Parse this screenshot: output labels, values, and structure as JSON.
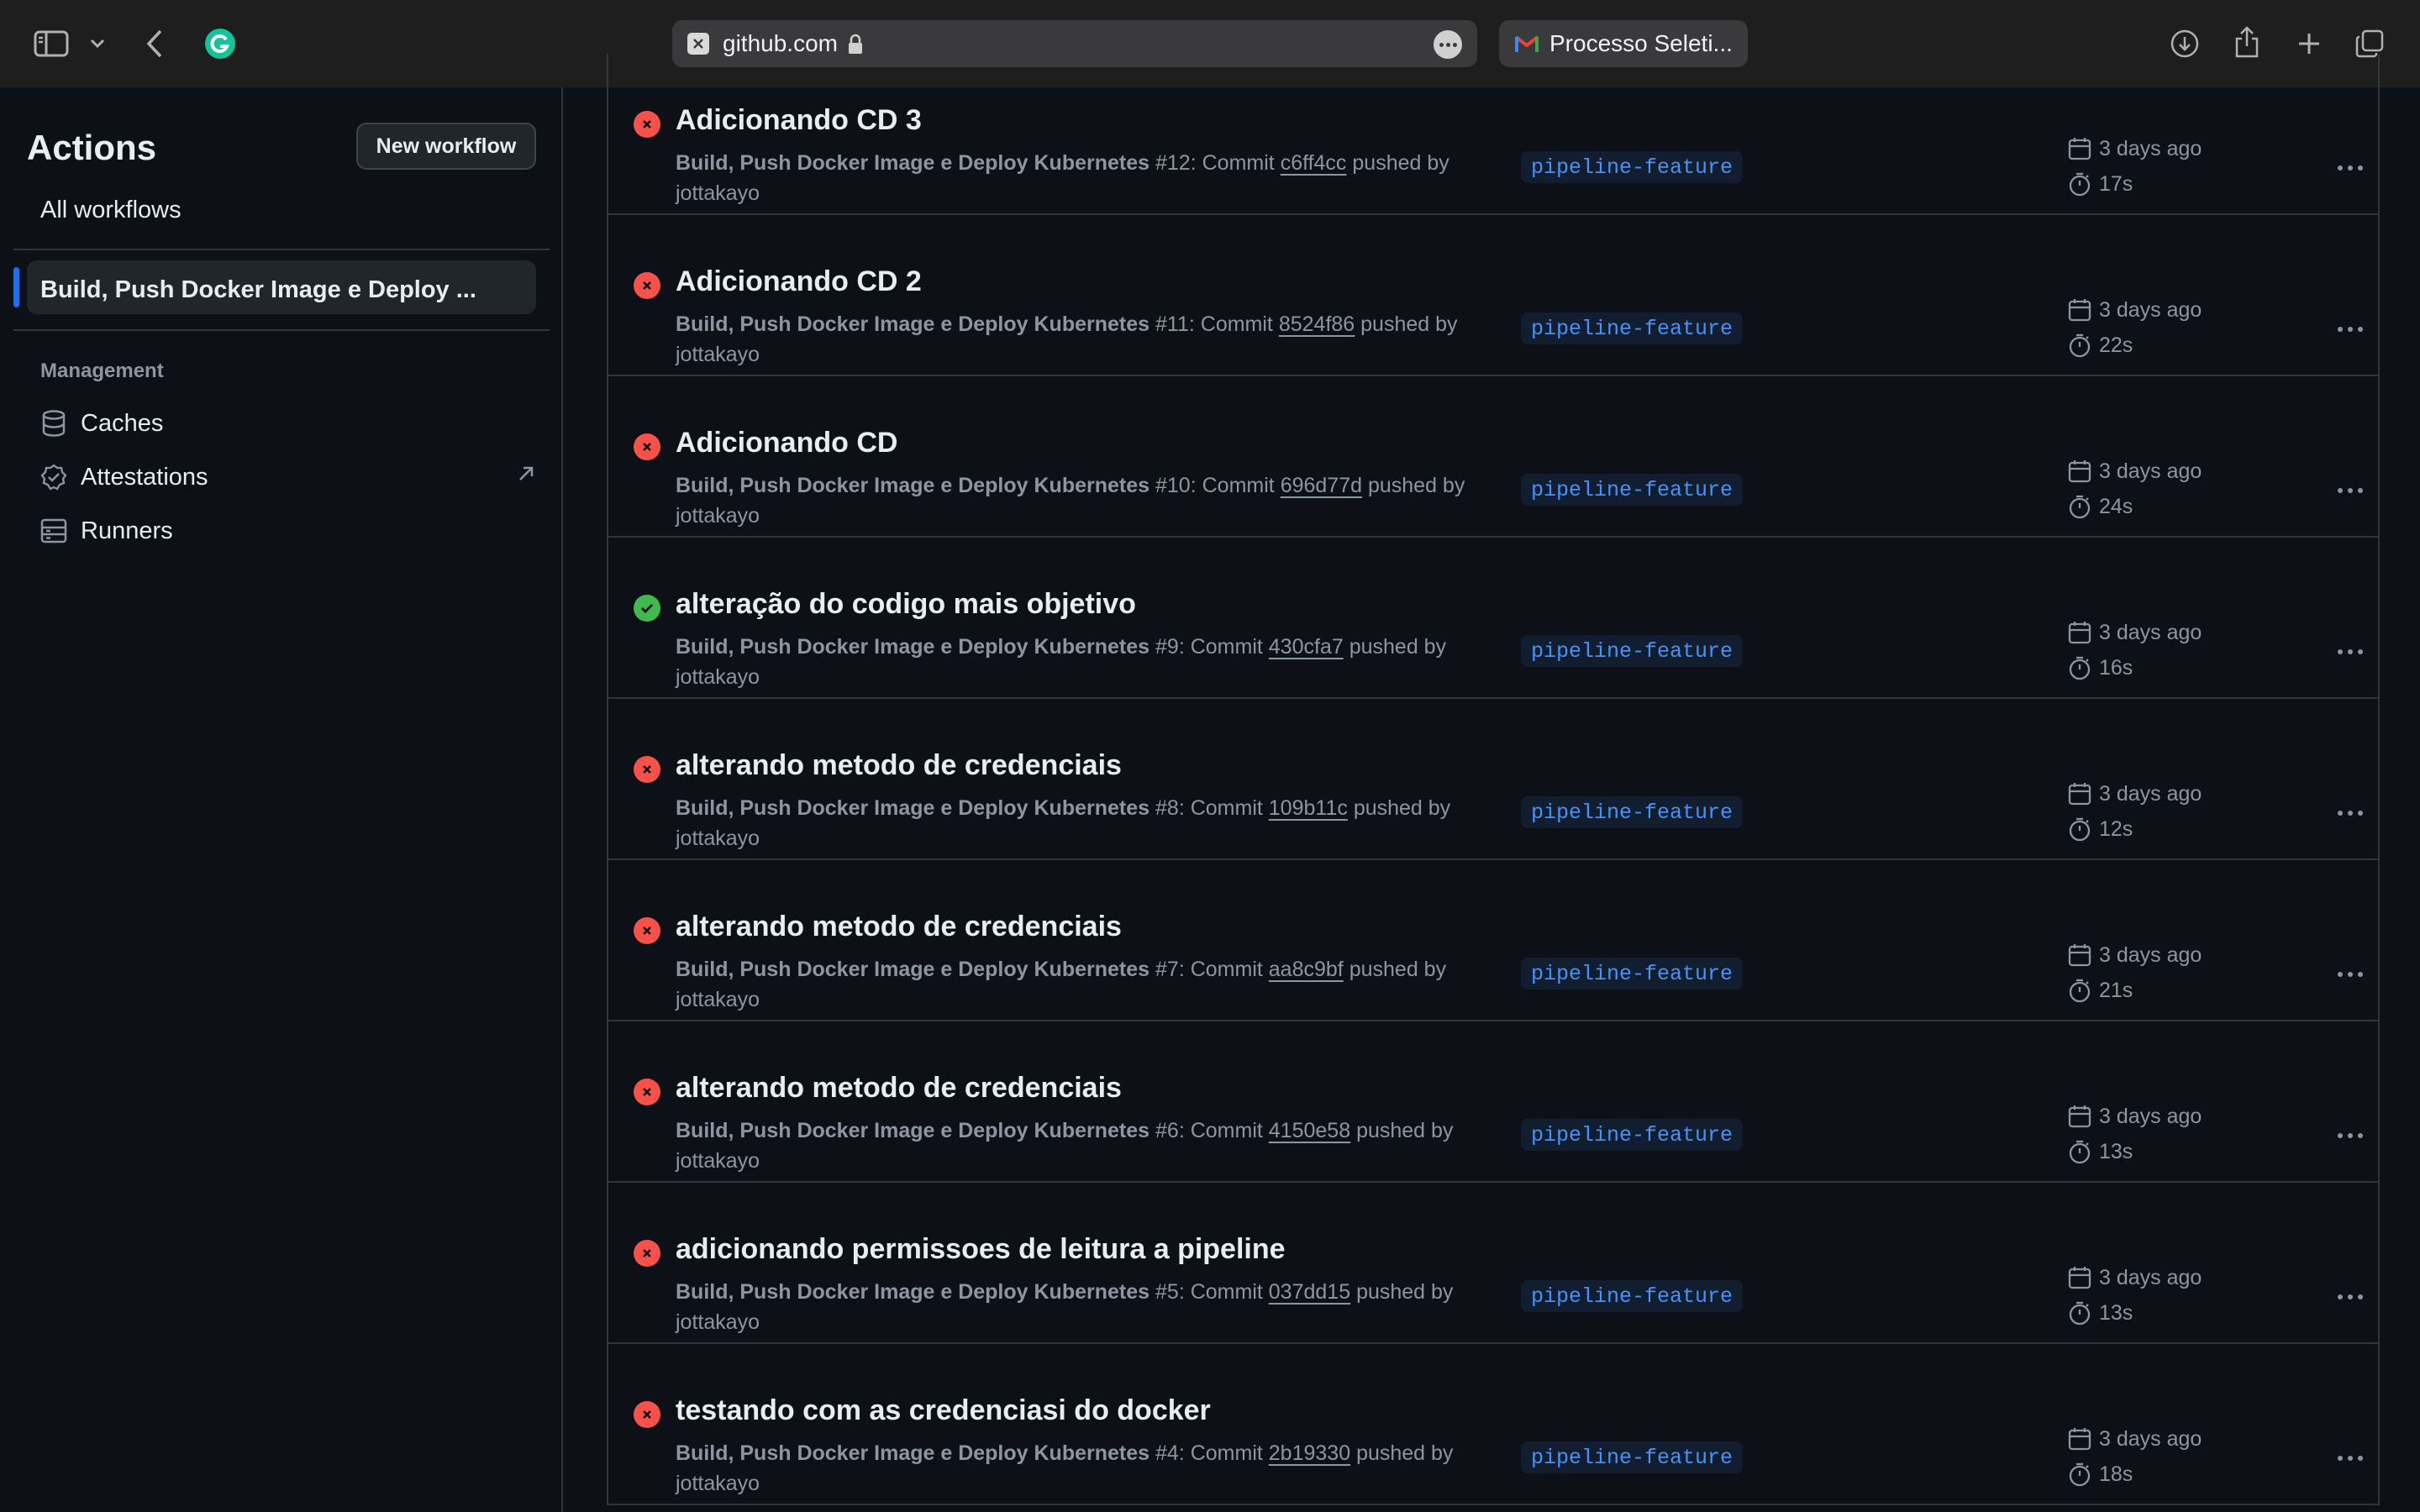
{
  "browser": {
    "url": "github.com",
    "tab2_title": "Processo Seleti..."
  },
  "sidebar": {
    "title": "Actions",
    "new_workflow": "New workflow",
    "all_workflows": "All workflows",
    "active_workflow": "Build, Push Docker Image e Deploy ...",
    "management_heading": "Management",
    "items": [
      {
        "label": "Caches",
        "icon": "database-icon"
      },
      {
        "label": "Attestations",
        "icon": "verified-check-icon"
      },
      {
        "label": "Runners",
        "icon": "server-icon"
      }
    ]
  },
  "runs": [
    {
      "title": "Adicionando CD 3",
      "status": "failure",
      "workflow": "Build, Push Docker Image e Deploy Kubernetes",
      "run": "#12",
      "sha": "c6ff4cc",
      "actor": "jottakayo",
      "branch": "pipeline-feature",
      "when": "3 days ago",
      "duration": "17s"
    },
    {
      "title": "Adicionando CD 2",
      "status": "failure",
      "workflow": "Build, Push Docker Image e Deploy Kubernetes",
      "run": "#11",
      "sha": "8524f86",
      "actor": "jottakayo",
      "branch": "pipeline-feature",
      "when": "3 days ago",
      "duration": "22s"
    },
    {
      "title": "Adicionando CD",
      "status": "failure",
      "workflow": "Build, Push Docker Image e Deploy Kubernetes",
      "run": "#10",
      "sha": "696d77d",
      "actor": "jottakayo",
      "branch": "pipeline-feature",
      "when": "3 days ago",
      "duration": "24s"
    },
    {
      "title": "alteração do codigo mais objetivo",
      "status": "success",
      "workflow": "Build, Push Docker Image e Deploy Kubernetes",
      "run": "#9",
      "sha": "430cfa7",
      "actor": "jottakayo",
      "branch": "pipeline-feature",
      "when": "3 days ago",
      "duration": "16s"
    },
    {
      "title": "alterando metodo de credenciais",
      "status": "failure",
      "workflow": "Build, Push Docker Image e Deploy Kubernetes",
      "run": "#8",
      "sha": "109b11c",
      "actor": "jottakayo",
      "branch": "pipeline-feature",
      "when": "3 days ago",
      "duration": "12s"
    },
    {
      "title": "alterando metodo de credenciais",
      "status": "failure",
      "workflow": "Build, Push Docker Image e Deploy Kubernetes",
      "run": "#7",
      "sha": "aa8c9bf",
      "actor": "jottakayo",
      "branch": "pipeline-feature",
      "when": "3 days ago",
      "duration": "21s"
    },
    {
      "title": "alterando metodo de credenciais",
      "status": "failure",
      "workflow": "Build, Push Docker Image e Deploy Kubernetes",
      "run": "#6",
      "sha": "4150e58",
      "actor": "jottakayo",
      "branch": "pipeline-feature",
      "when": "3 days ago",
      "duration": "13s"
    },
    {
      "title": "adicionando permissoes de leitura a pipeline",
      "status": "failure",
      "workflow": "Build, Push Docker Image e Deploy Kubernetes",
      "run": "#5",
      "sha": "037dd15",
      "actor": "jottakayo",
      "branch": "pipeline-feature",
      "when": "3 days ago",
      "duration": "13s"
    },
    {
      "title": "testando com as credenciasi do docker",
      "status": "failure",
      "workflow": "Build, Push Docker Image e Deploy Kubernetes",
      "run": "#4",
      "sha": "2b19330",
      "actor": "jottakayo",
      "branch": "pipeline-feature",
      "when": "3 days ago",
      "duration": "18s"
    }
  ],
  "strings": {
    "commit": "Commit",
    "pushed_by": "pushed by"
  },
  "colors": {
    "failure": "#f85149",
    "success": "#3fb950",
    "accent": "#1f6feb",
    "branch_text": "#4493f8"
  }
}
